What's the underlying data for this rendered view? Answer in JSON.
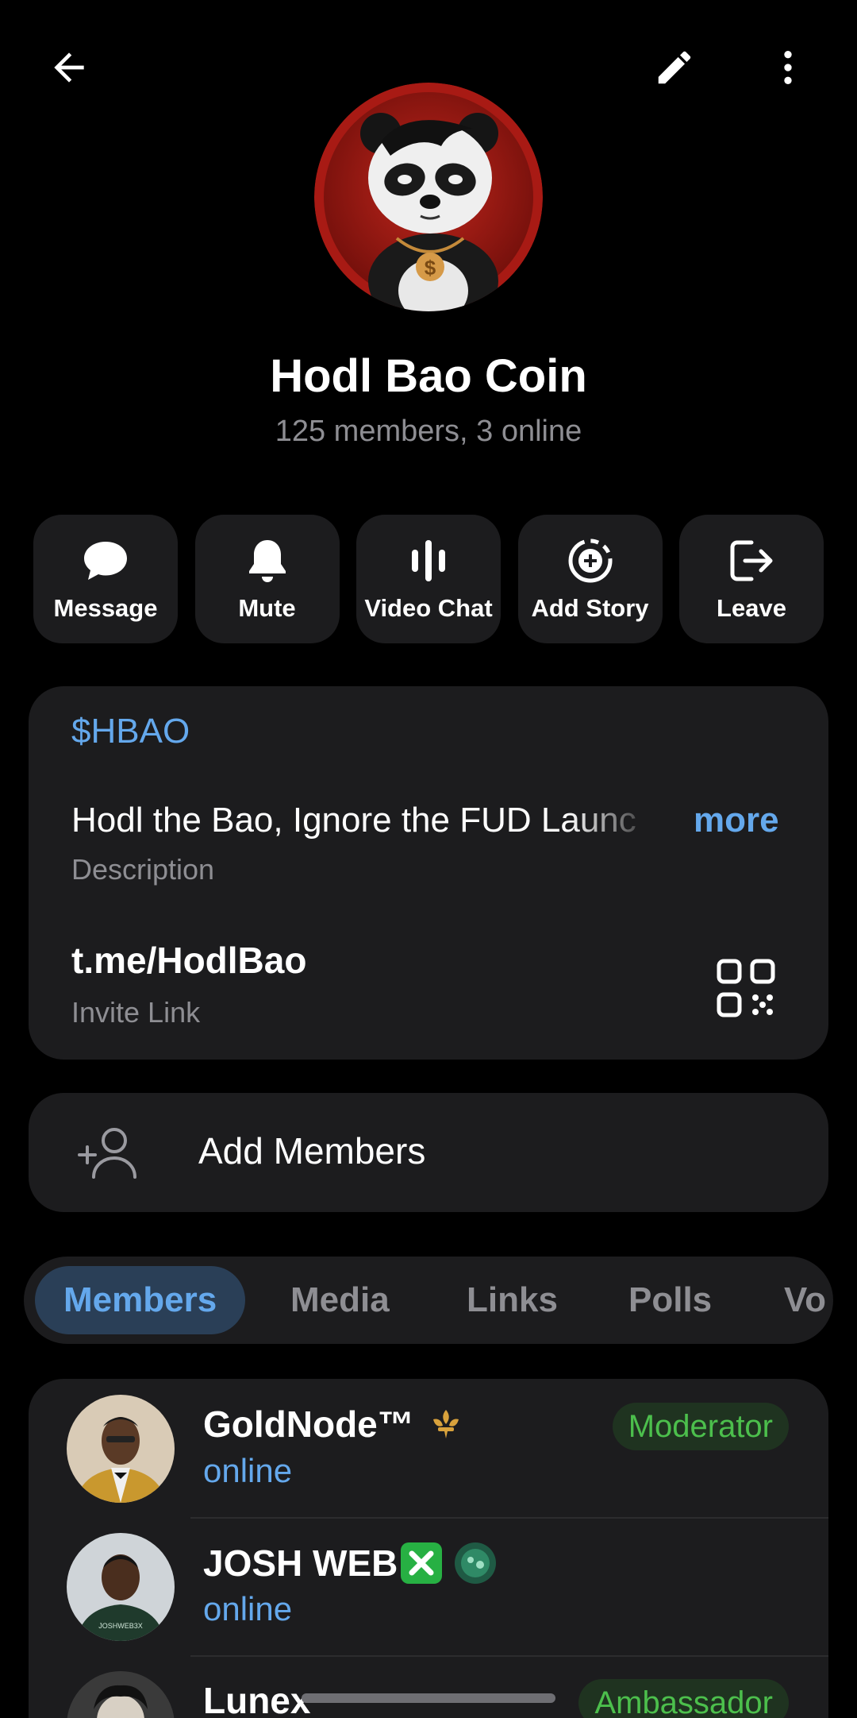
{
  "header": {
    "back_icon": "arrow-left-icon",
    "edit_icon": "pencil-icon",
    "more_icon": "more-vertical-icon"
  },
  "profile": {
    "title": "Hodl Bao Coin",
    "subtitle": "125 members, 3 online"
  },
  "actions": [
    {
      "label": "Message",
      "icon": "chat-bubble-icon"
    },
    {
      "label": "Mute",
      "icon": "bell-icon"
    },
    {
      "label": "Video Chat",
      "icon": "voice-bars-icon"
    },
    {
      "label": "Add Story",
      "icon": "add-story-icon"
    },
    {
      "label": "Leave",
      "icon": "logout-icon"
    }
  ],
  "info": {
    "handle": "$HBAO",
    "description": "Hodl the Bao, Ignore the FUD  Launc",
    "more": "more",
    "description_label": "Description",
    "link": "t.me/HodlBao",
    "link_label": "Invite Link"
  },
  "add_members": {
    "label": "Add Members"
  },
  "tabs": [
    "Members",
    "Media",
    "Links",
    "Polls",
    "Vo"
  ],
  "members": [
    {
      "name": "GoldNode™",
      "status": "online",
      "role": "Moderator"
    },
    {
      "name": "JOSH WEB",
      "status": "online",
      "role": ""
    },
    {
      "name": "Lunex",
      "status": "",
      "role": "Ambassador"
    }
  ],
  "colors": {
    "accent": "#64a8ec",
    "role_green": "#4cbf4c",
    "card": "#1c1c1e",
    "background": "#000000"
  }
}
